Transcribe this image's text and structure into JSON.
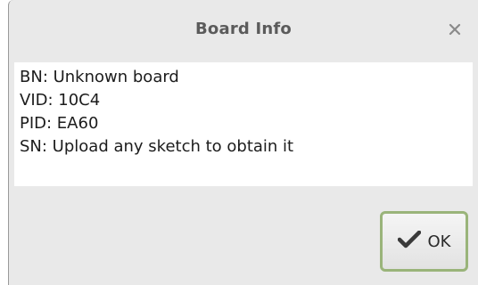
{
  "dialog": {
    "title": "Board Info",
    "close_icon": "close-icon",
    "info_lines": [
      "BN: Unknown board",
      "VID: 10C4",
      "PID: EA60",
      "SN: Upload any sketch to obtain it"
    ],
    "ok_button": {
      "label": "OK",
      "icon": "checkmark-icon"
    }
  },
  "colors": {
    "dialog_bg": "#e9e9e9",
    "info_bg": "#ffffff",
    "title_text": "#5b5b5b",
    "ok_border": "#9ab47a"
  }
}
